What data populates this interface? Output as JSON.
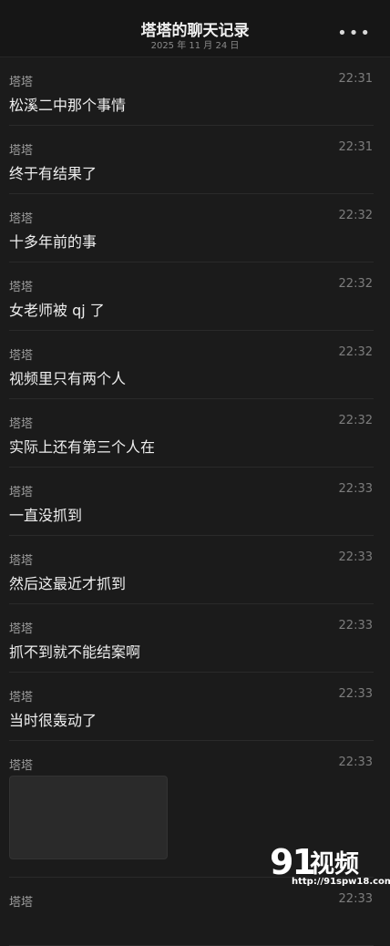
{
  "header": {
    "title": "塔塔的聊天记录",
    "subtitle": "2025 年 11 月 24 日",
    "more_icon": "•••"
  },
  "messages": [
    {
      "sender": "塔塔",
      "time": "22:31",
      "text": "松溪二中那个事情"
    },
    {
      "sender": "塔塔",
      "time": "22:31",
      "text": "终于有结果了"
    },
    {
      "sender": "塔塔",
      "time": "22:32",
      "text": "十多年前的事"
    },
    {
      "sender": "塔塔",
      "time": "22:32",
      "text": "女老师被 qj 了"
    },
    {
      "sender": "塔塔",
      "time": "22:32",
      "text": "视频里只有两个人"
    },
    {
      "sender": "塔塔",
      "time": "22:32",
      "text": "实际上还有第三个人在"
    },
    {
      "sender": "塔塔",
      "time": "22:33",
      "text": "一直没抓到"
    },
    {
      "sender": "塔塔",
      "time": "22:33",
      "text": "然后这最近才抓到"
    },
    {
      "sender": "塔塔",
      "time": "22:33",
      "text": "抓不到就不能结案啊"
    },
    {
      "sender": "塔塔",
      "time": "22:33",
      "text": "当时很轰动了"
    },
    {
      "sender": "塔塔",
      "time": "22:33",
      "image_placeholder": ""
    },
    {
      "sender": "塔塔",
      "time": "22:33"
    }
  ],
  "watermark": {
    "number": "91",
    "word": "视频",
    "url": "http://91spw18.com"
  }
}
